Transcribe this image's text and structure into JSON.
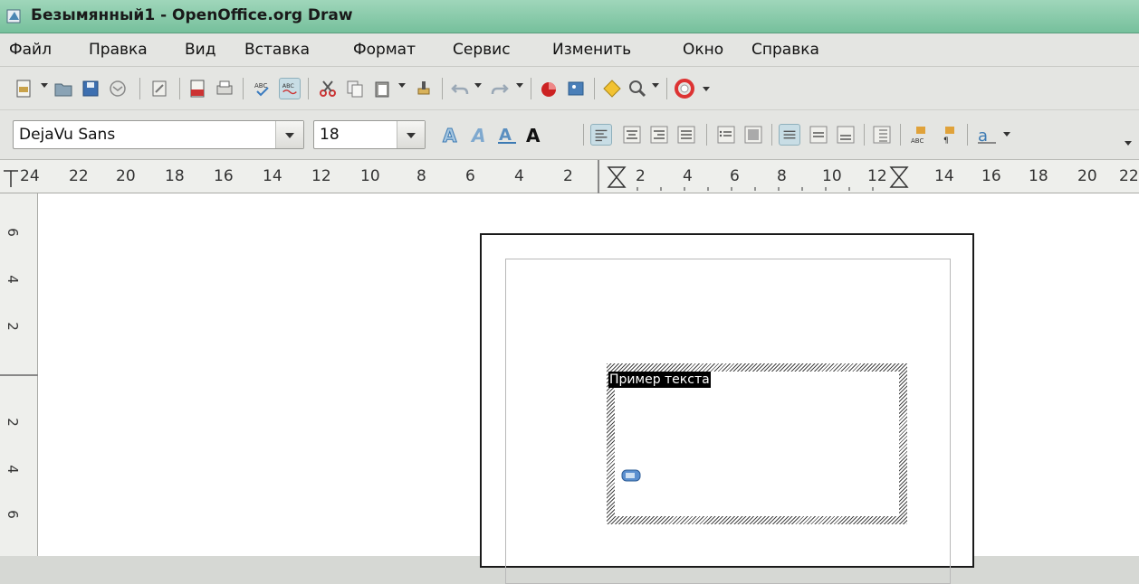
{
  "window": {
    "title": "Безымянный1 - OpenOffice.org Draw"
  },
  "menu": [
    "Файл",
    "Правка",
    "Вид",
    "Вставка",
    "Формат",
    "Сервис",
    "Изменить",
    "Окно",
    "Справка"
  ],
  "formatting": {
    "font_name": "DejaVu Sans",
    "font_size": "18"
  },
  "ruler": {
    "horizontal": [
      "24",
      "22",
      "20",
      "18",
      "16",
      "14",
      "12",
      "10",
      "8",
      "6",
      "4",
      "2",
      "2",
      "4",
      "6",
      "8",
      "10",
      "12",
      "14",
      "16",
      "18",
      "20",
      "22"
    ],
    "vertical": [
      "6",
      "4",
      "2",
      "2",
      "4",
      "6"
    ]
  },
  "canvas": {
    "sample_text": "Пример текста"
  },
  "colors": {
    "titlebar": "#86c9a8",
    "toolbar": "#e4e5e2",
    "selection": "#000000"
  }
}
